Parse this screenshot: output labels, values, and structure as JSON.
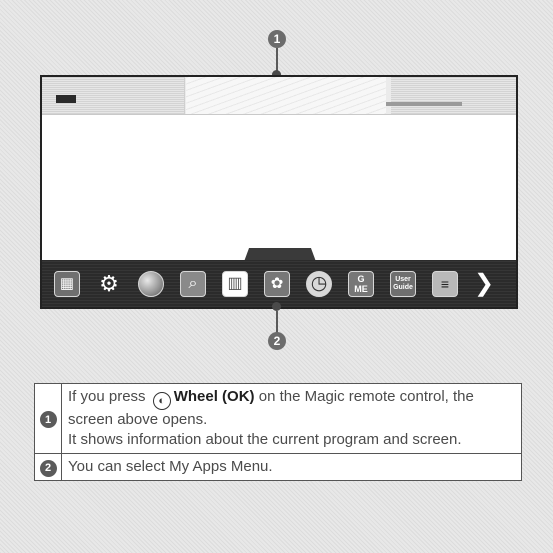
{
  "callouts": {
    "top": "1",
    "bottom": "2"
  },
  "icons": [
    "tv-app-icon",
    "settings-gear-icon",
    "globe-icon",
    "search-icon",
    "smart-share-icon",
    "app-store-icon",
    "clock-icon",
    "game-icon",
    "user-guide-icon",
    "premium-icon",
    "next-arrow-icon"
  ],
  "launcher": {
    "game_top": "G",
    "game_bottom": "ME",
    "user_guide_line1": "User",
    "user_guide_line2": "Guide"
  },
  "legend": {
    "rows": [
      {
        "num": "1",
        "part1": "If you press",
        "icon_label": "Wheel (OK)",
        "part2": "on the Magic remote control, the screen above opens.",
        "line2": "It shows information about the current program and screen."
      },
      {
        "num": "2",
        "text": "You can select My Apps Menu."
      }
    ]
  },
  "colors": {
    "page_bg": "#e8e8e8",
    "screen_border": "#222222",
    "launcher_bg": "#2b2b2b",
    "callout": "#6c6c6c"
  }
}
